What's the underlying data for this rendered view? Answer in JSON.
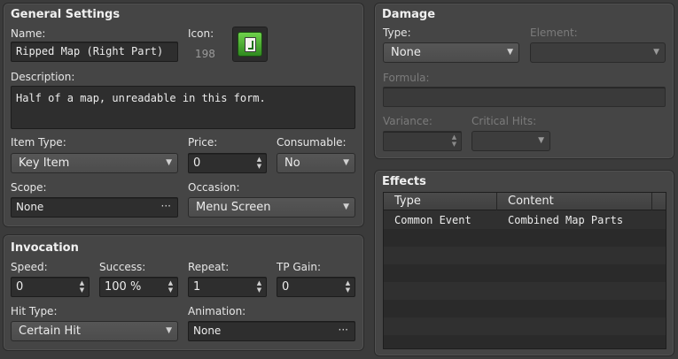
{
  "general": {
    "title": "General Settings",
    "name_label": "Name:",
    "name_value": "Ripped Map (Right Part)",
    "icon_label": "Icon:",
    "icon_index": "198",
    "icon_name": "map-piece-icon",
    "description_label": "Description:",
    "description_value": "Half of a map, unreadable in this form.",
    "item_type_label": "Item Type:",
    "item_type_value": "Key Item",
    "price_label": "Price:",
    "price_value": "0",
    "consumable_label": "Consumable:",
    "consumable_value": "No",
    "scope_label": "Scope:",
    "scope_value": "None",
    "occasion_label": "Occasion:",
    "occasion_value": "Menu Screen"
  },
  "invocation": {
    "title": "Invocation",
    "speed_label": "Speed:",
    "speed_value": "0",
    "success_label": "Success:",
    "success_value": "100 %",
    "repeat_label": "Repeat:",
    "repeat_value": "1",
    "tp_gain_label": "TP Gain:",
    "tp_gain_value": "0",
    "hit_type_label": "Hit Type:",
    "hit_type_value": "Certain Hit",
    "animation_label": "Animation:",
    "animation_value": "None"
  },
  "damage": {
    "title": "Damage",
    "type_label": "Type:",
    "type_value": "None",
    "element_label": "Element:",
    "element_value": "",
    "formula_label": "Formula:",
    "formula_value": "",
    "variance_label": "Variance:",
    "variance_value": "",
    "critical_label": "Critical Hits:",
    "critical_value": ""
  },
  "effects": {
    "title": "Effects",
    "columns": [
      "Type",
      "Content"
    ],
    "rows": [
      {
        "type": "Common Event",
        "content": "Combined Map Parts"
      }
    ]
  },
  "colors": {
    "background": "#3b3b3b",
    "panel": "#454545",
    "field": "#2e2e2e",
    "icon_green": "#4caf35"
  }
}
